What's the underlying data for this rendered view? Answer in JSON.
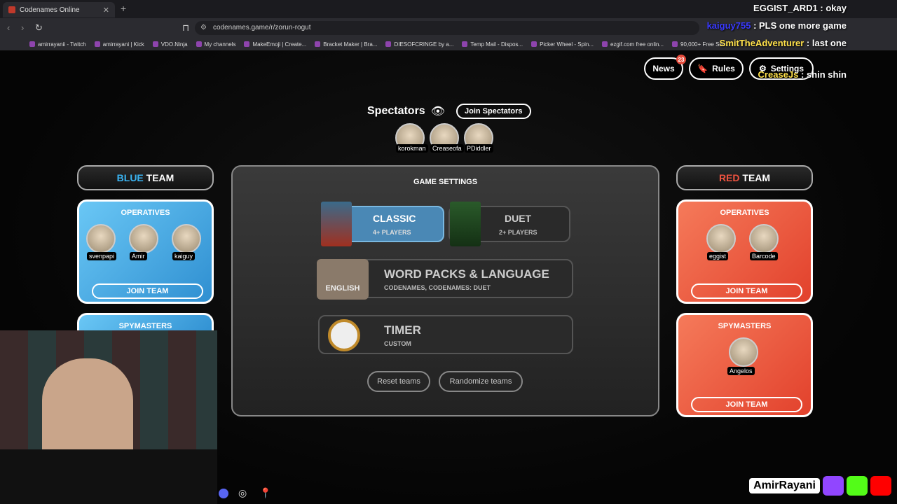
{
  "browser": {
    "tab_title": "Codenames Online",
    "url": "codenames.game/r/zorun-rogut",
    "bookmarks": [
      "amirrayanii - Twitch",
      "amirrayani | Kick",
      "VDO.Ninja",
      "My channels",
      "MakeEmoji | Create...",
      "Bracket Maker | Bra...",
      "DIESOFCRINGE by a...",
      "Temp Mail - Dispos...",
      "Picker Wheel - Spin...",
      "ezgif.com free onlin...",
      "90,000+ Free Sou..."
    ]
  },
  "topnav": {
    "news": "News",
    "news_badge": "23",
    "rules": "Rules",
    "settings": "Settings"
  },
  "spectators": {
    "title": "Spectators",
    "join": "Join Spectators",
    "names": [
      "korokman",
      "Creaseofa",
      "PDiddler"
    ]
  },
  "blue": {
    "head_color": "BLUE",
    "head_team": "TEAM",
    "operatives_title": "OPERATIVES",
    "operatives": [
      "svenpapi",
      "Amir",
      "kaiguy"
    ],
    "join": "JOIN TEAM",
    "spymasters_title": "SPYMASTERS"
  },
  "red": {
    "head_color": "RED",
    "head_team": "TEAM",
    "operatives_title": "OPERATIVES",
    "operatives": [
      "eggist",
      "Barcode"
    ],
    "join": "JOIN TEAM",
    "spymasters_title": "SPYMASTERS",
    "spymasters": [
      "Angelos"
    ],
    "spy_join": "JOIN TEAM"
  },
  "settings": {
    "title": "GAME SETTINGS",
    "classic": "CLASSIC",
    "classic_sub": "4+ PLAYERS",
    "duet": "DUET",
    "duet_sub": "2+ PLAYERS",
    "wordpacks": "WORD PACKS & LANGUAGE",
    "wordpacks_sub": "CODENAMES, CODENAMES: DUET",
    "english": "ENGLISH",
    "timer": "TIMER",
    "timer_sub": "CUSTOM",
    "reset": "Reset teams",
    "randomize": "Randomize teams"
  },
  "chat": [
    {
      "user": "EGGIST_ARD1",
      "msg": "okay"
    },
    {
      "user": "kaiguy755",
      "msg": "PLS one more game"
    },
    {
      "user": "SmitTheAdventurer",
      "msg": "last one"
    },
    {
      "user": "CreaseJs",
      "msg": "shin shin"
    }
  ],
  "overlay_name": "AmirRayani"
}
